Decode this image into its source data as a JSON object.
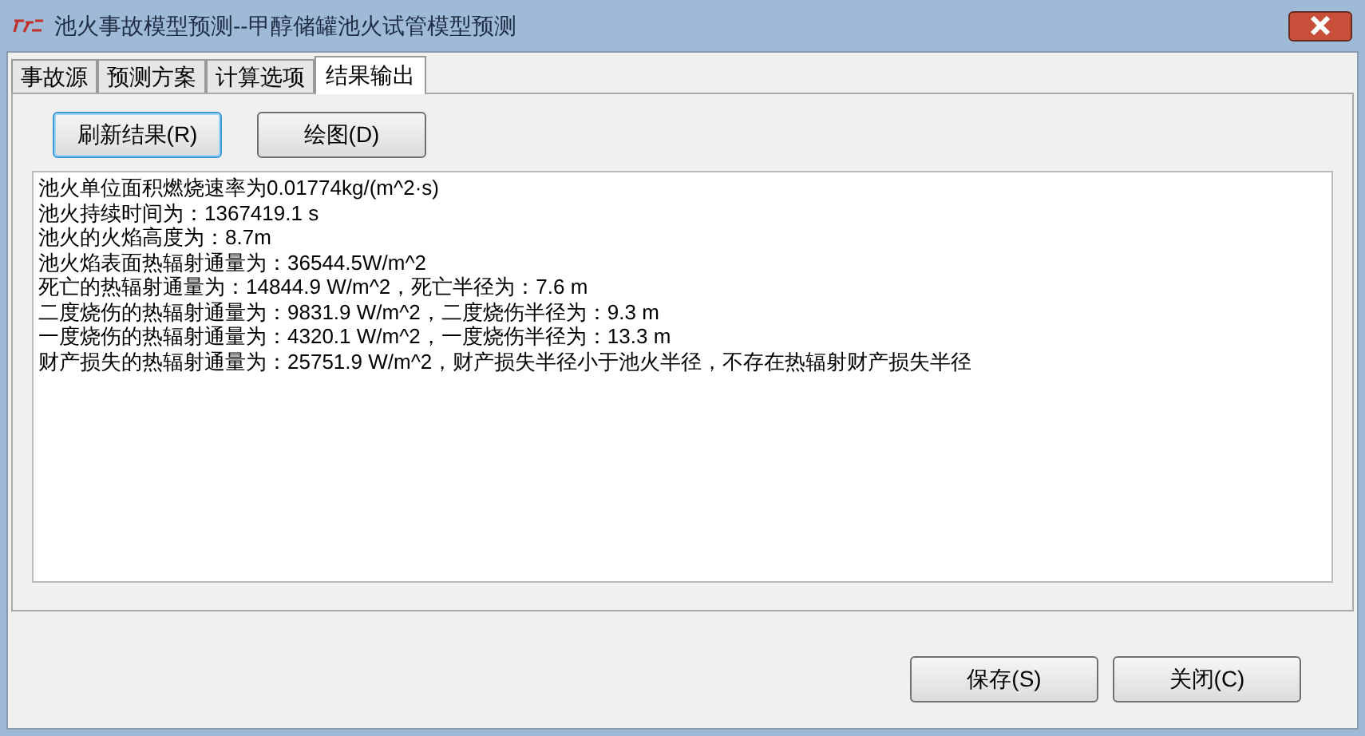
{
  "window": {
    "title": "池火事故模型预测--甲醇储罐池火试管模型预测"
  },
  "tabs": [
    {
      "label": "事故源",
      "selected": false
    },
    {
      "label": "预测方案",
      "selected": false
    },
    {
      "label": "计算选项",
      "selected": false
    },
    {
      "label": "结果输出",
      "selected": true
    }
  ],
  "toolbar_buttons": [
    {
      "label": "刷新结果(R)",
      "focused": true
    },
    {
      "label": "绘图(D)",
      "focused": false
    }
  ],
  "results": [
    "池火单位面积燃烧速率为0.01774kg/(m^2·s)",
    "池火持续时间为：1367419.1 s",
    "池火的火焰高度为：8.7m",
    "池火焰表面热辐射通量为：36544.5W/m^2",
    "死亡的热辐射通量为：14844.9 W/m^2，死亡半径为：7.6 m",
    "二度烧伤的热辐射通量为：9831.9 W/m^2，二度烧伤半径为：9.3 m",
    "一度烧伤的热辐射通量为：4320.1 W/m^2，一度烧伤半径为：13.3 m",
    "财产损失的热辐射通量为：25751.9 W/m^2，财产损失半径小于池火半径，不存在热辐射财产损失半径"
  ],
  "footer_buttons": [
    "保存(S)",
    "关闭(C)"
  ]
}
